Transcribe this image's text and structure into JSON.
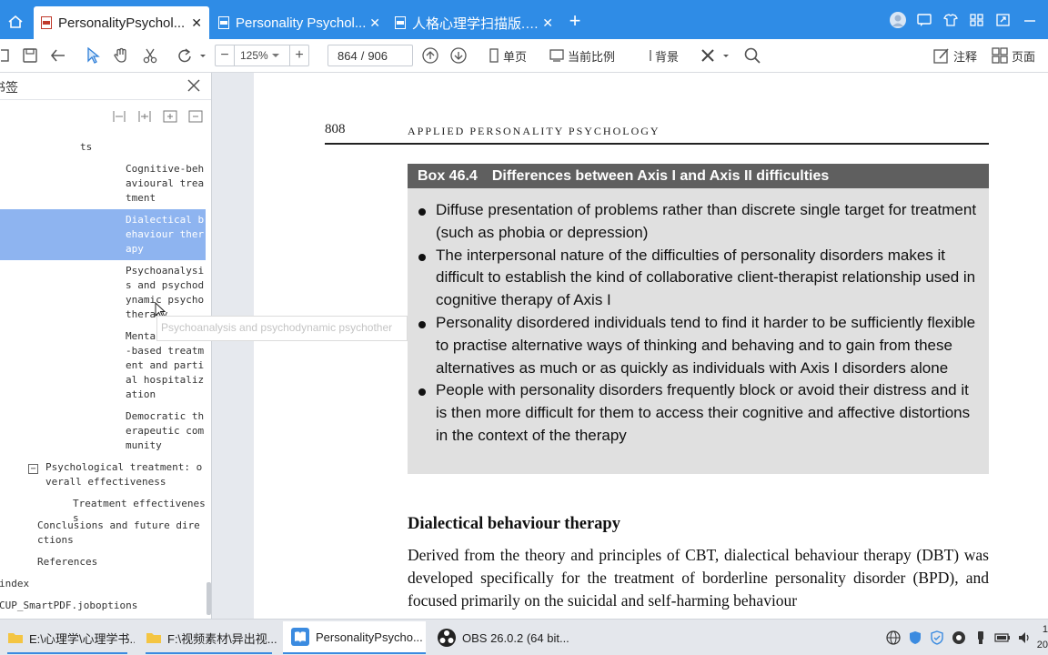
{
  "tabs": [
    {
      "label": "PersonalityPsychol...",
      "close": "✕"
    },
    {
      "label": "Personality Psychol...",
      "close": "✕"
    },
    {
      "label": "人格心理学扫描版.p...",
      "close": "✕"
    }
  ],
  "new_tab": "+",
  "toolbar": {
    "zoom_minus": "−",
    "zoom_value": "125%",
    "zoom_plus": "+",
    "page_current": "864",
    "page_sep": "/",
    "page_total": "906",
    "single_page": "单页",
    "fit_ratio": "当前比例",
    "background": "背景",
    "annotate": "注释",
    "page_view": "页面"
  },
  "sidebar": {
    "search_title": "书签",
    "outline": [
      {
        "text": "ts"
      },
      {
        "text": "Cognitive-behavioural treatment"
      },
      {
        "text": "Dialectical behaviour therapy"
      },
      {
        "text": "Psychoanalysis and psychodynamic psychotherapy"
      },
      {
        "text": "Mentalization-based treatment and partial hospitalization"
      },
      {
        "text": "Democratic therapeutic community"
      },
      {
        "text": "Psychological treatment: overall effectiveness"
      },
      {
        "text": "Treatment effectiveness"
      },
      {
        "text": "Conclusions and future directions"
      },
      {
        "text": "References"
      },
      {
        "text": "index"
      },
      {
        "text": "CUP_SmartPDF.joboptions"
      }
    ],
    "collapse_toggle": "−"
  },
  "tooltip": "Psychoanalysis and psychodynamic psychother",
  "document": {
    "page_number": "808",
    "running_title": "APPLIED PERSONALITY PSYCHOLOGY",
    "box_number": "Box 46.4",
    "box_title": "Differences between Axis I and Axis II difficulties",
    "bullets": [
      "Diffuse presentation of problems rather than discrete single target for treatment (such as phobia or depression)",
      "The interpersonal nature of the difficulties of personality disorders makes it difficult to establish the kind of collaborative client-therapist relationship used in cognitive therapy of Axis I",
      "Personality disordered individuals tend to find it harder to be sufficiently flexible to practise alternative ways of thinking and behaving and to gain from these alternatives as much or as quickly as individuals with Axis I disorders alone",
      "People with personality disorders frequently block or avoid their distress and it is then more difficult for them to access their cognitive and affective distortions in the context of the therapy"
    ],
    "section_title": "Dialectical behaviour therapy",
    "section_body": "Derived from the theory and principles of CBT, dialectical behaviour therapy (DBT) was developed specifically for the treatment of borderline personality disorder (BPD), and focused primarily on the suicidal and self-harming behaviour"
  },
  "taskbar": {
    "items": [
      {
        "label": "E:\\心理学\\心理学书..."
      },
      {
        "label": "F:\\视频素材\\异出视..."
      },
      {
        "label": "PersonalityPsycho..."
      },
      {
        "label": "OBS 26.0.2 (64 bit..."
      }
    ],
    "clock_time": "1",
    "clock_date": "20"
  },
  "colors": {
    "tabbar": "#2f8ce6",
    "highlight": "#8eb4f0",
    "box_header": "#5f5f5f",
    "box_body": "#e0e0e0"
  }
}
